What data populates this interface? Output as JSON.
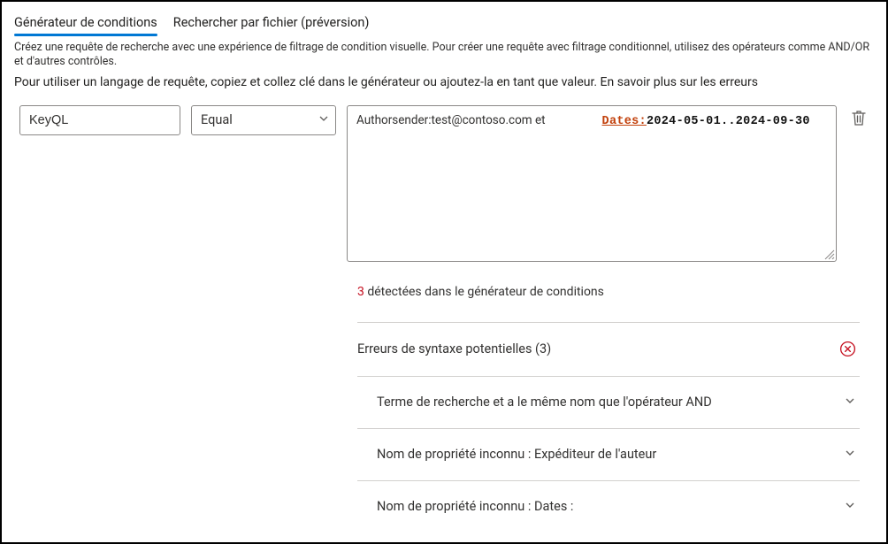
{
  "tabs": {
    "conditions": "Générateur de conditions",
    "byfile": "Rechercher par fichier (préversion)"
  },
  "desc1": "Créez une requête de recherche avec une expérience de filtrage de condition visuelle. Pour créer une requête avec filtrage conditionnel, utilisez des opérateurs comme AND/OR et d'autres contrôles.",
  "desc2": "Pour utiliser un langage de requête, copiez et collez clé dans le générateur ou ajoutez-la en tant que valeur. En savoir plus sur les erreurs",
  "property": {
    "value": "KeyQL"
  },
  "operator": {
    "value": "Equal"
  },
  "query": {
    "part1": "Authorsender:test@contoso.com et",
    "datesLabel": "Dates:",
    "datesValue": "2024-05-01..2024-09-30"
  },
  "summary": {
    "count": "3",
    "text": " détectées dans le générateur de conditions"
  },
  "errors": {
    "groupTitle": "Erreurs de syntaxe potentielles (3)",
    "items": [
      "Terme de recherche et a le même nom que l'opérateur AND",
      "Nom de propriété inconnu : Expéditeur de l'auteur",
      "Nom de propriété inconnu : Dates :"
    ]
  }
}
